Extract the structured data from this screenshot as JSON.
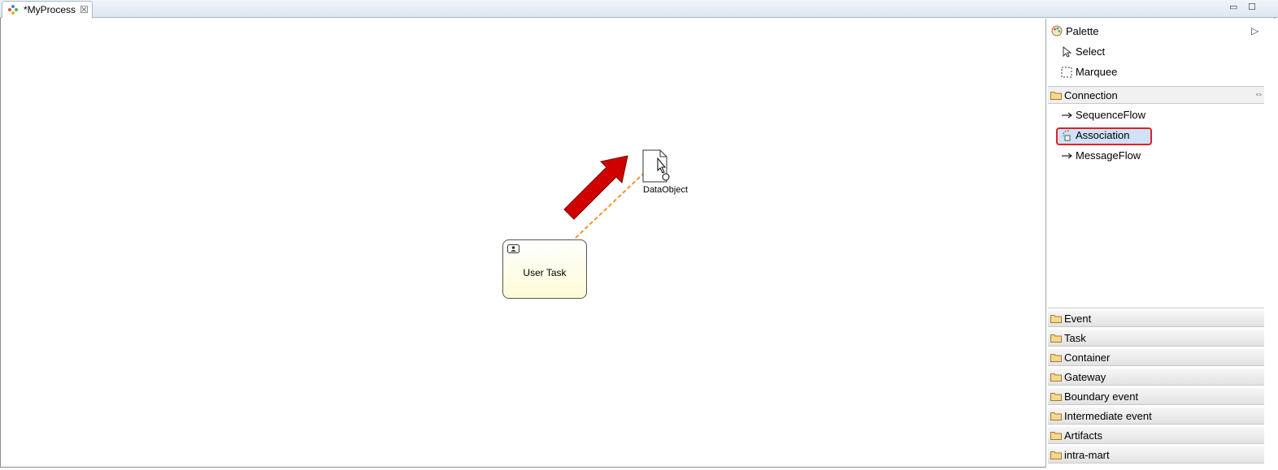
{
  "tab": {
    "title": "*MyProcess",
    "close_glyph": "☒",
    "icon": "process-icon"
  },
  "window_controls": {
    "minimize": "▭",
    "maximize": "☐"
  },
  "diagram": {
    "user_task_label": "User Task",
    "data_object_label": "DataObject"
  },
  "palette": {
    "title": "Palette",
    "expand_glyph": "▷",
    "tools": [
      {
        "label": "Select",
        "icon": "arrow-cursor-icon"
      },
      {
        "label": "Marquee",
        "icon": "marquee-icon"
      }
    ],
    "connection": {
      "label": "Connection",
      "pin_glyph": "⇔",
      "items": [
        {
          "label": "SequenceFlow",
          "icon": "arrow-right-icon"
        },
        {
          "label": "Association",
          "icon": "association-icon"
        },
        {
          "label": "MessageFlow",
          "icon": "arrow-right-icon"
        }
      ]
    },
    "drawers": [
      {
        "label": "Event"
      },
      {
        "label": "Task"
      },
      {
        "label": "Container"
      },
      {
        "label": "Gateway"
      },
      {
        "label": "Boundary event"
      },
      {
        "label": "Intermediate event"
      },
      {
        "label": "Artifacts"
      },
      {
        "label": "intra-mart"
      }
    ]
  },
  "colors": {
    "highlight_border": "#e0202a",
    "arrow": "#d00000",
    "association_line": "#f0962c"
  }
}
